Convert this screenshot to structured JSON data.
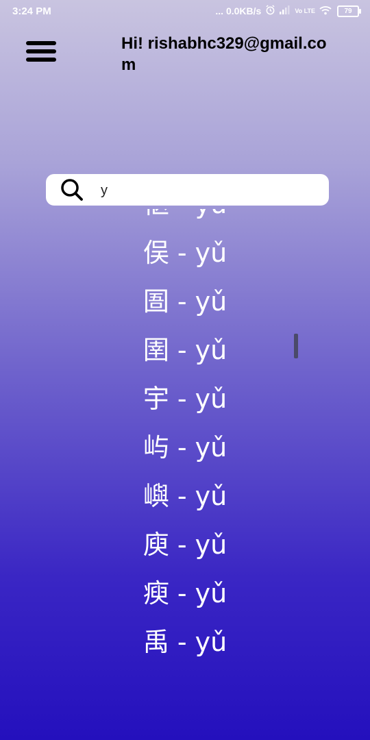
{
  "status_bar": {
    "time": "3:24 PM",
    "network_speed": "... 0.0KB/s",
    "alarm_icon": "alarm-icon",
    "signal_icon": "signal-icon",
    "volte_label": "Vo LTE",
    "wifi_icon": "wifi-icon",
    "battery_level": "79"
  },
  "header": {
    "menu_icon": "hamburger-menu-icon",
    "greeting": "Hi! rishabhc329@gmail.com"
  },
  "search": {
    "icon": "search-icon",
    "value": "y",
    "placeholder": ""
  },
  "results": [
    {
      "hanzi": "伛",
      "pinyin": "yǔ"
    },
    {
      "hanzi": "俣",
      "pinyin": "yǔ"
    },
    {
      "hanzi": "圄",
      "pinyin": "yǔ"
    },
    {
      "hanzi": "圉",
      "pinyin": "yǔ"
    },
    {
      "hanzi": "宇",
      "pinyin": "yǔ"
    },
    {
      "hanzi": "屿",
      "pinyin": "yǔ"
    },
    {
      "hanzi": "嶼",
      "pinyin": "yǔ"
    },
    {
      "hanzi": "庾",
      "pinyin": "yǔ"
    },
    {
      "hanzi": "瘐",
      "pinyin": "yǔ"
    },
    {
      "hanzi": "禹",
      "pinyin": "yǔ"
    }
  ],
  "separator": "-",
  "colors": {
    "gradient_top": "#c9c4e0",
    "gradient_bottom": "#2410bd",
    "text_light": "#ffffff",
    "text_dark": "#000000"
  }
}
